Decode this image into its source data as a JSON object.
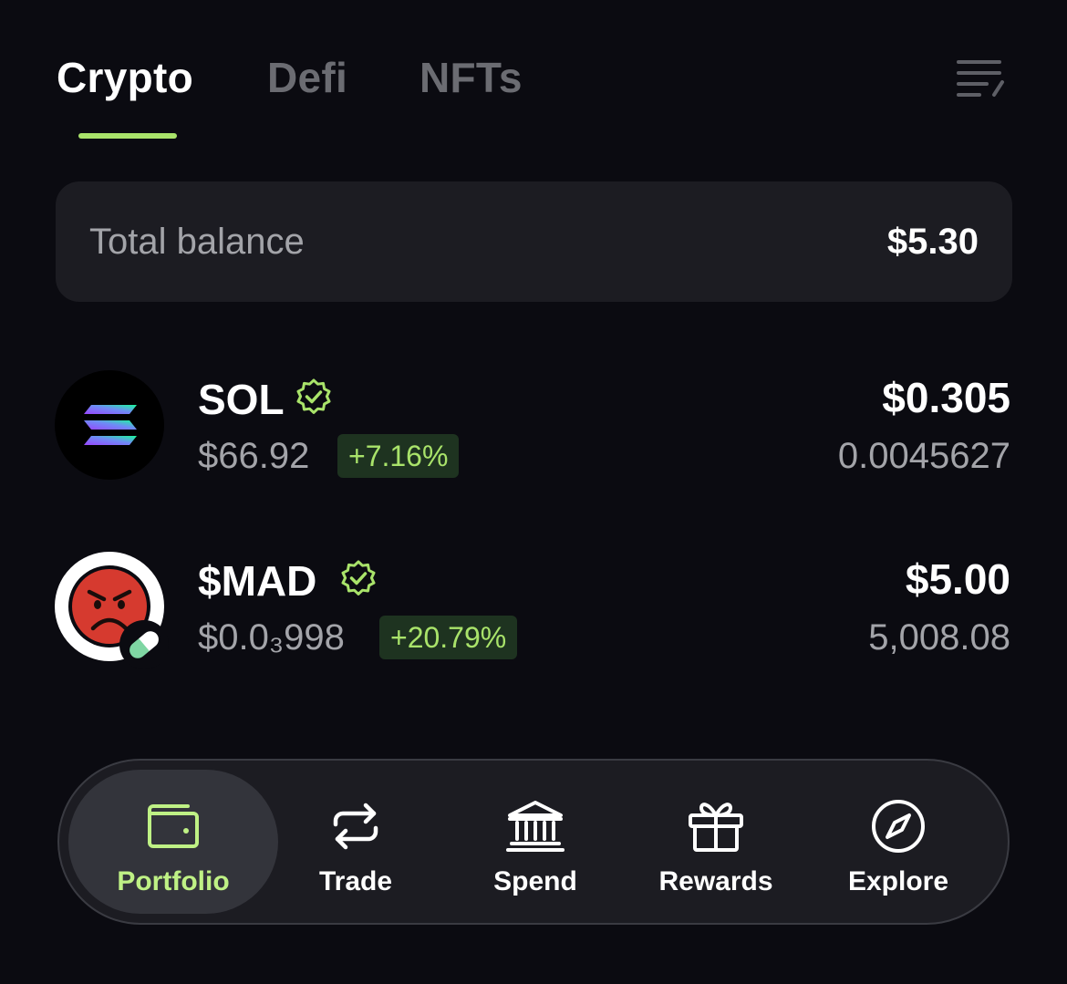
{
  "tabs": {
    "items": [
      {
        "label": "Crypto",
        "active": true
      },
      {
        "label": "Defi",
        "active": false
      },
      {
        "label": "NFTs",
        "active": false
      }
    ],
    "filter_icon": "filter-list-icon"
  },
  "balance": {
    "label": "Total balance",
    "value": "$5.30"
  },
  "tokens": [
    {
      "name": "SOL",
      "verified": true,
      "price": "$66.92",
      "change": "+7.16%",
      "value": "$0.305",
      "amount": "0.0045627",
      "icon": "solana-logo-icon"
    },
    {
      "name": "$MAD",
      "verified": true,
      "price": "$0.0₃998",
      "change": "+20.79%",
      "value": "$5.00",
      "amount": "5,008.08",
      "icon": "angry-face-logo-icon"
    }
  ],
  "nav": {
    "items": [
      {
        "label": "Portfolio",
        "icon": "wallet-icon",
        "active": true
      },
      {
        "label": "Trade",
        "icon": "swap-arrows-icon",
        "active": false
      },
      {
        "label": "Spend",
        "icon": "bank-icon",
        "active": false
      },
      {
        "label": "Rewards",
        "icon": "gift-icon",
        "active": false
      },
      {
        "label": "Explore",
        "icon": "compass-icon",
        "active": false
      }
    ]
  },
  "colors": {
    "background": "#0b0b11",
    "card": "#1c1c22",
    "accent_green": "#a9e36a",
    "badge_bg": "#1e3320",
    "muted_text": "#a3a4a9"
  }
}
